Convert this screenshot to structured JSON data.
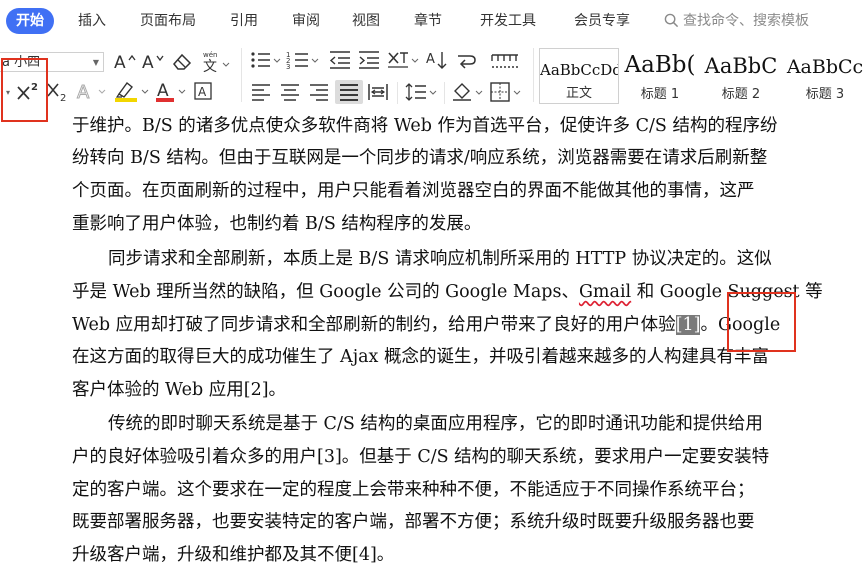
{
  "tabs": [
    {
      "label": "开始",
      "active": true
    },
    {
      "label": "插入"
    },
    {
      "label": "页面布局"
    },
    {
      "label": "引用"
    },
    {
      "label": "审阅"
    },
    {
      "label": "视图"
    },
    {
      "label": "章节"
    },
    {
      "label": "开发工具"
    },
    {
      "label": "会员专享"
    }
  ],
  "search": {
    "placeholder": "查找命令、搜索模板"
  },
  "ribbon": {
    "font_size": "a 小四",
    "styles": [
      {
        "sample": "AaBbCcDd",
        "label": "正文"
      },
      {
        "sample": "AaBb(",
        "label": "标题 1"
      },
      {
        "sample": "AaBbC",
        "label": "标题 2"
      },
      {
        "sample": "AaBbCc",
        "label": "标题 3"
      }
    ],
    "font_color": "#e03030",
    "highlight_color": "#f2d600"
  },
  "document": {
    "lines": [
      "于维护。B/S 的诸多优点使众多软件商将 Web 作为首选平台，促使许多 C/S 结构的程序纷",
      "纷转向 B/S 结构。但由于互联网是一个同步的请求/响应系统，浏览器需要在请求后刷新整",
      "个页面。在页面刷新的过程中，用户只能看着浏览器空白的界面不能做其他的事情，这严",
      "重影响了用户体验，也制约着 B/S 结构程序的发展。",
      "同步请求和全部刷新，本质上是 B/S 请求响应机制所采用的 HTTP 协议决定的。这似",
      "乎是 Web 理所当然的缺陷，但 Google 公司的 Google Maps、",
      "Gmail",
      " 和 Google Suggest 等",
      "Web 应用却打破了同步请求和全部刷新的制约，给用户带来了良好的用户体验",
      "[1]",
      "。Google",
      "在这方面的取得巨大的成功催生了 Ajax 概念的诞生，并吸引着越来越多的人构建具有丰富",
      "客户体验的 Web 应用[2]。",
      "传统的即时聊天系统是基于 C/S 结构的桌面应用程序，它的即时通讯功能和提供给用",
      "户的良好体验吸引着众多的用户[3]。但基于 C/S 结构的聊天系统，要求用户一定要安装特",
      "定的客户端。这个要求在一定的程度上会带来种种不便，不能适应于不同操作系统平台；",
      "既要部署服务器，也要安装特定的客户端，部署不方便；系统升级时既要升级服务器也要",
      "升级客户端，升级和维护都及其不便[4]。"
    ]
  }
}
